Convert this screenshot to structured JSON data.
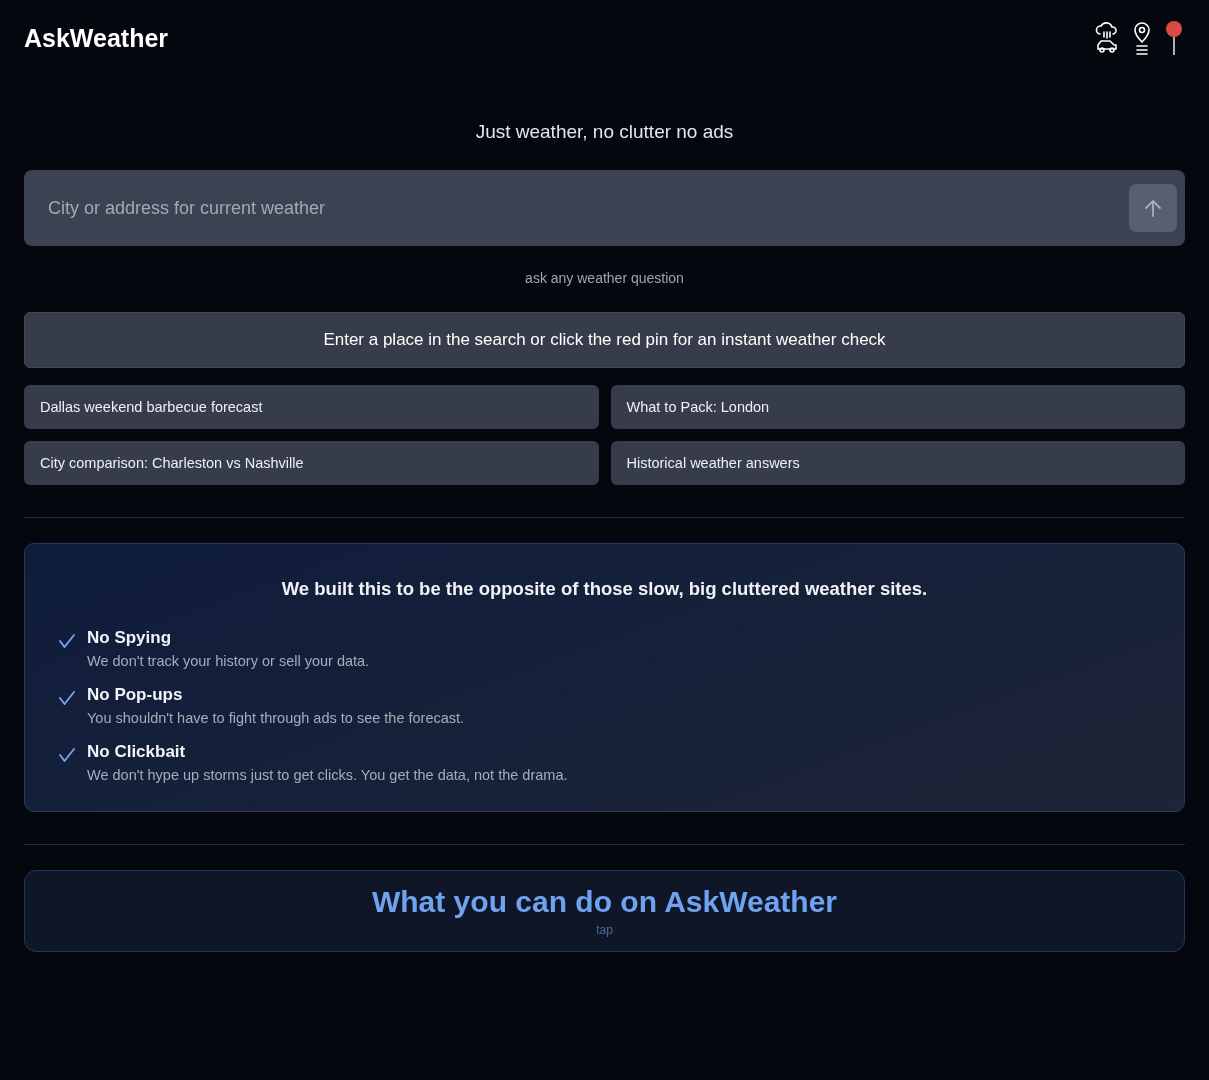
{
  "header": {
    "logo": "AskWeather"
  },
  "tagline": "Just weather, no clutter no ads",
  "search": {
    "placeholder": "City or address for current weather"
  },
  "hint": "ask any weather question",
  "banner": "Enter a place in the search or click the red pin for an instant weather check",
  "suggestions": [
    "Dallas weekend barbecue forecast",
    "What to Pack: London",
    "City comparison: Charleston vs Nashville",
    "Historical weather answers"
  ],
  "promise": {
    "title": "We built this to be the opposite of those slow, big cluttered weather sites.",
    "items": [
      {
        "title": "No Spying",
        "text": "We don't track your history or sell your data."
      },
      {
        "title": "No Pop-ups",
        "text": "You shouldn't have to fight through ads to see the forecast."
      },
      {
        "title": "No Clickbait",
        "text": "We don't hype up storms just to get clicks. You get the data, not the drama."
      }
    ]
  },
  "features": {
    "title": "What you can do on AskWeather",
    "hint": "tap"
  }
}
